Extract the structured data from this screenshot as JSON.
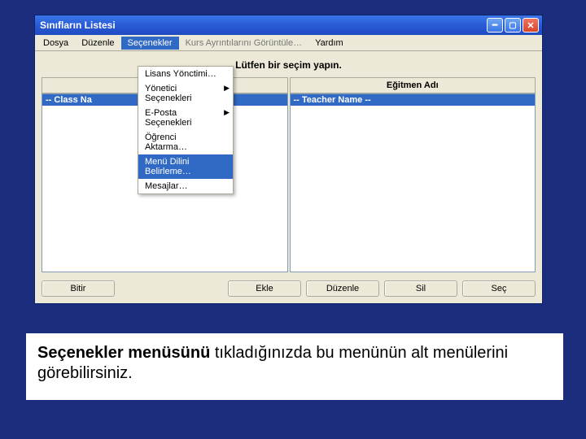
{
  "window": {
    "title": "Sınıfların Listesi"
  },
  "menubar": {
    "file": "Dosya",
    "edit": "Düzenle",
    "options": "Seçenekler",
    "course": "Kurs Ayrıntılarını Görüntüle…",
    "help": "Yardım"
  },
  "dropdown": {
    "license": "Lisans Yönctimi…",
    "admin": "Yönetici Seçenekleri",
    "email": "E-Posta Seçenekleri",
    "student": "Öğrenci Aktarma…",
    "lang": "Menü Dilini Belirleme…",
    "msgs": "Mesajlar…"
  },
  "prompt": "Lütfen bir seçim yapın.",
  "columns": {
    "left": "",
    "right": "Eğitmen Adı"
  },
  "rows": {
    "left": "-- Class Na",
    "right": "-- Teacher Name --"
  },
  "buttons": {
    "done": "Bitir",
    "add": "Ekle",
    "edit": "Düzenle",
    "delete": "Sil",
    "select": "Seç"
  },
  "caption": {
    "bold": "Seçenekler menüsünü",
    "rest": "  tıkladığınızda bu menünün alt menülerini görebilirsiniz."
  }
}
